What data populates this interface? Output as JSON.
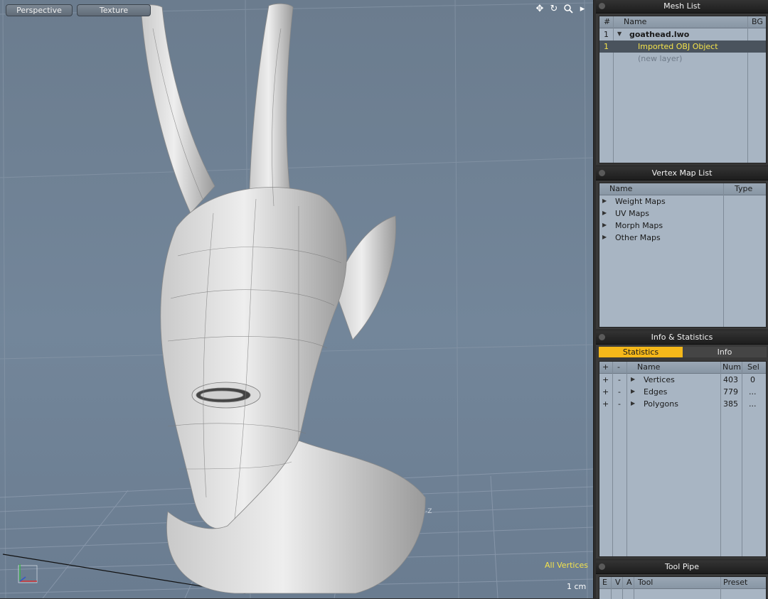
{
  "viewport": {
    "view_label": "Perspective",
    "shading_label": "Texture",
    "icons": [
      "move-icon",
      "rotate-icon",
      "zoom-icon",
      "menu-arrow-icon"
    ],
    "selection_mode": "All Vertices",
    "scale_label": "1 cm"
  },
  "mesh_list": {
    "title": "Mesh List",
    "columns": [
      "#",
      "Name",
      "BG"
    ],
    "rows": [
      {
        "num": "1",
        "name": "goathead.lwo"
      },
      {
        "num": "1",
        "name": "Imported OBJ Object"
      },
      {
        "num": "",
        "name": "(new layer)"
      }
    ]
  },
  "vertex_map_list": {
    "title": "Vertex Map List",
    "columns": [
      "Name",
      "Type"
    ],
    "items": [
      "Weight Maps",
      "UV Maps",
      "Morph Maps",
      "Other Maps"
    ]
  },
  "info_stats": {
    "title": "Info & Statistics",
    "tabs": [
      "Statistics",
      "Info"
    ],
    "columns": [
      "+",
      "-",
      "Name",
      "Num",
      "Sel"
    ],
    "rows": [
      {
        "plus": "+",
        "minus": "-",
        "name": "Vertices",
        "num": "403",
        "sel": "0"
      },
      {
        "plus": "+",
        "minus": "-",
        "name": "Edges",
        "num": "779",
        "sel": "..."
      },
      {
        "plus": "+",
        "minus": "-",
        "name": "Polygons",
        "num": "385",
        "sel": "..."
      }
    ]
  },
  "tool_pipe": {
    "title": "Tool Pipe",
    "columns": [
      "E",
      "V",
      "A",
      "Tool",
      "Preset"
    ]
  },
  "colors": {
    "accent": "#f5b81a",
    "selection_text": "#f4e34b",
    "viewport_bg": "#6b7c8e"
  }
}
